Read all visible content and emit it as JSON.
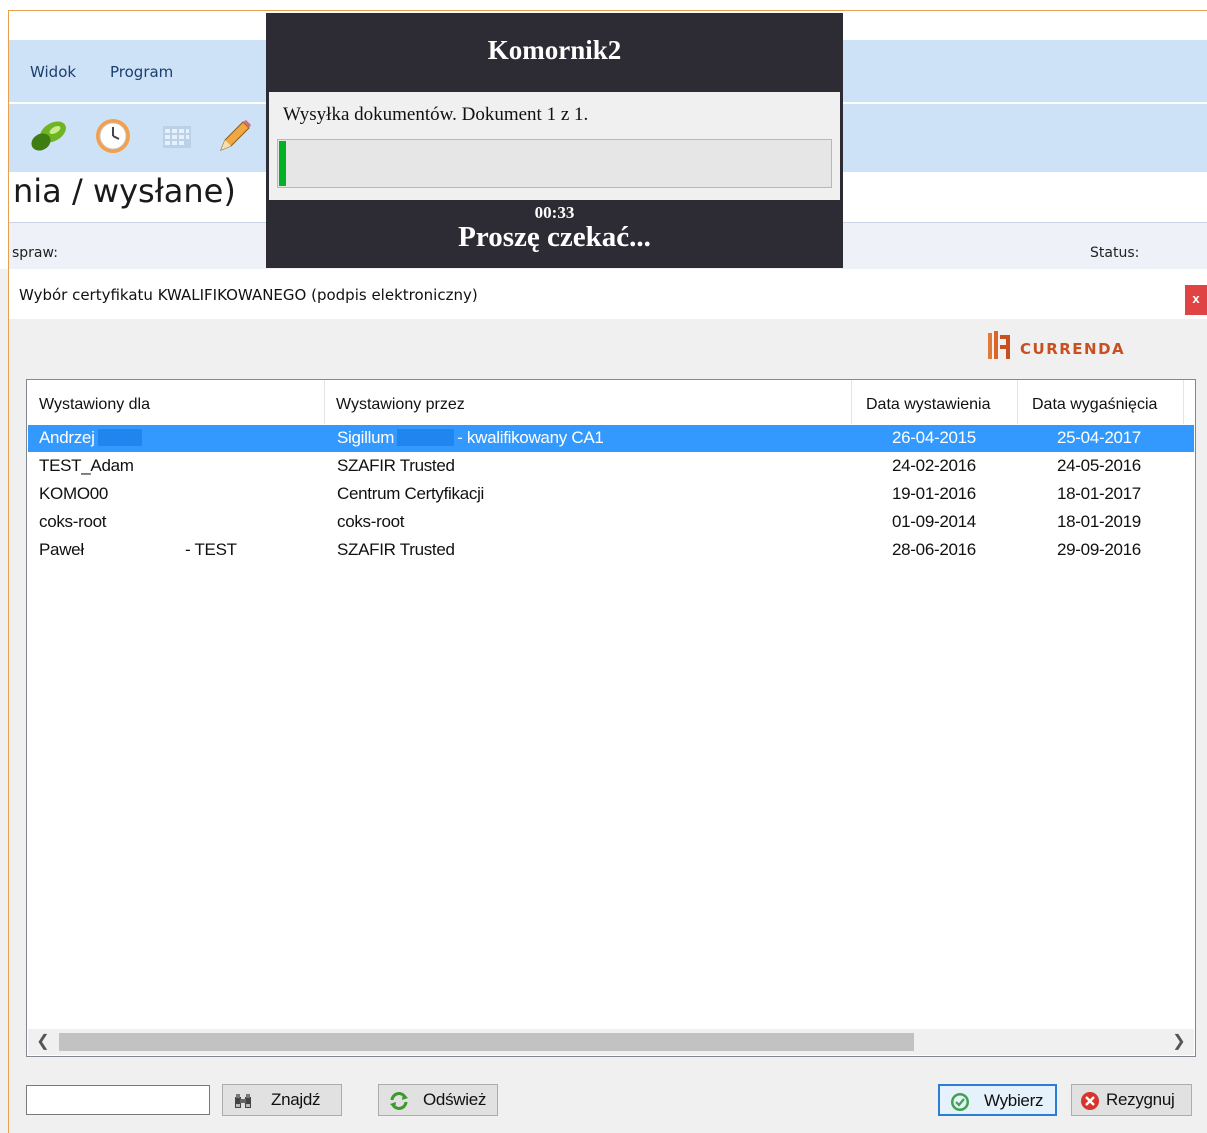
{
  "background_app": {
    "menu": [
      "Widok",
      "Program"
    ],
    "toolbar_icons": [
      "pill-icon",
      "clock-icon",
      "calendar-icon",
      "pencil-icon"
    ],
    "heading": "nia / wysłane)",
    "filter_left_label": "spraw:",
    "filter_right_label": "Status:"
  },
  "progress": {
    "title": "Komornik2",
    "message": "Wysyłka dokumentów. Dokument 1 z 1.",
    "progress_fraction": 0.012,
    "progress_color": "#06b025",
    "elapsed": "00:33",
    "wait_text": "Proszę czekać..."
  },
  "dialog": {
    "title": "Wybór certyfikatu KWALIFIKOWANEGO (podpis elektroniczny)",
    "close_label": "x",
    "logo_text": "CURRENDA",
    "columns": [
      "Wystawiony dla",
      "Wystawiony przez",
      "Data wystawienia",
      "Data wygaśnięcia"
    ],
    "rows": [
      {
        "for": "Andrzej",
        "for_suffix": "",
        "by": "Sigillum",
        "by_suffix": "- kwalifikowany CA1",
        "issued": "26-04-2015",
        "expires": "25-04-2017",
        "selected": true
      },
      {
        "for": "TEST_Adam",
        "for_suffix": "",
        "by": "SZAFIR Trusted",
        "by_suffix": "",
        "issued": "24-02-2016",
        "expires": "24-05-2016",
        "selected": false
      },
      {
        "for": "KOMO00",
        "for_suffix": "",
        "by": "Centrum Certyfikacji",
        "by_suffix": "",
        "issued": "19-01-2016",
        "expires": "18-01-2017",
        "selected": false
      },
      {
        "for": "coks-root",
        "for_suffix": "",
        "by": "coks-root",
        "by_suffix": "",
        "issued": "01-09-2014",
        "expires": "18-01-2019",
        "selected": false
      },
      {
        "for": "Paweł",
        "for_suffix": "- TEST",
        "by": "SZAFIR Trusted",
        "by_suffix": "",
        "issued": "28-06-2016",
        "expires": "29-09-2016",
        "selected": false
      }
    ],
    "search_value": "",
    "buttons": {
      "find": "Znajdź",
      "refresh": "Odśwież",
      "select": "Wybierz",
      "cancel": "Rezygnuj"
    },
    "accent": "#3399ff"
  }
}
